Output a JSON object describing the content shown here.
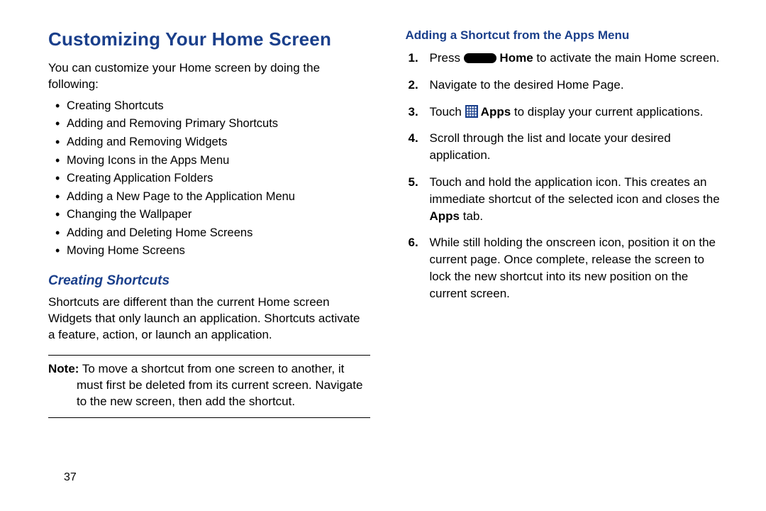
{
  "pageNumber": "37",
  "title": "Customizing Your Home Screen",
  "intro": "You can customize your Home screen by doing the following:",
  "bullets": [
    "Creating Shortcuts",
    "Adding and Removing Primary Shortcuts",
    "Adding and Removing Widgets",
    "Moving Icons in the Apps Menu",
    "Creating Application Folders",
    "Adding a New Page to the Application Menu",
    "Changing the Wallpaper",
    "Adding and Deleting Home Screens",
    "Moving Home Screens"
  ],
  "creatingShortcuts": {
    "heading": "Creating Shortcuts",
    "body": "Shortcuts are different than the current Home screen Widgets that only launch an application. Shortcuts activate a feature, action, or launch an application.",
    "noteLabel": "Note:",
    "noteBody": "To move a shortcut from one screen to another, it must first be deleted from its current screen. Navigate to the new screen, then add the shortcut."
  },
  "addingShortcut": {
    "heading": "Adding a Shortcut from the Apps Menu",
    "step1_press": "Press ",
    "step1_home": " Home",
    "step1_rest": " to activate the main Home screen.",
    "step2": "Navigate to the desired Home Page.",
    "step3_touch": "Touch ",
    "step3_apps": " Apps",
    "step3_rest": " to display your current applications.",
    "step4": "Scroll through the list and locate your desired application.",
    "step5_a": "Touch and hold the application icon. This creates an immediate shortcut of the selected icon and closes the ",
    "step5_apps": "Apps",
    "step5_b": " tab.",
    "step6": "While still holding the onscreen icon, position it on the current page. Once complete, release the screen to lock the new shortcut into its new position on the current screen."
  }
}
